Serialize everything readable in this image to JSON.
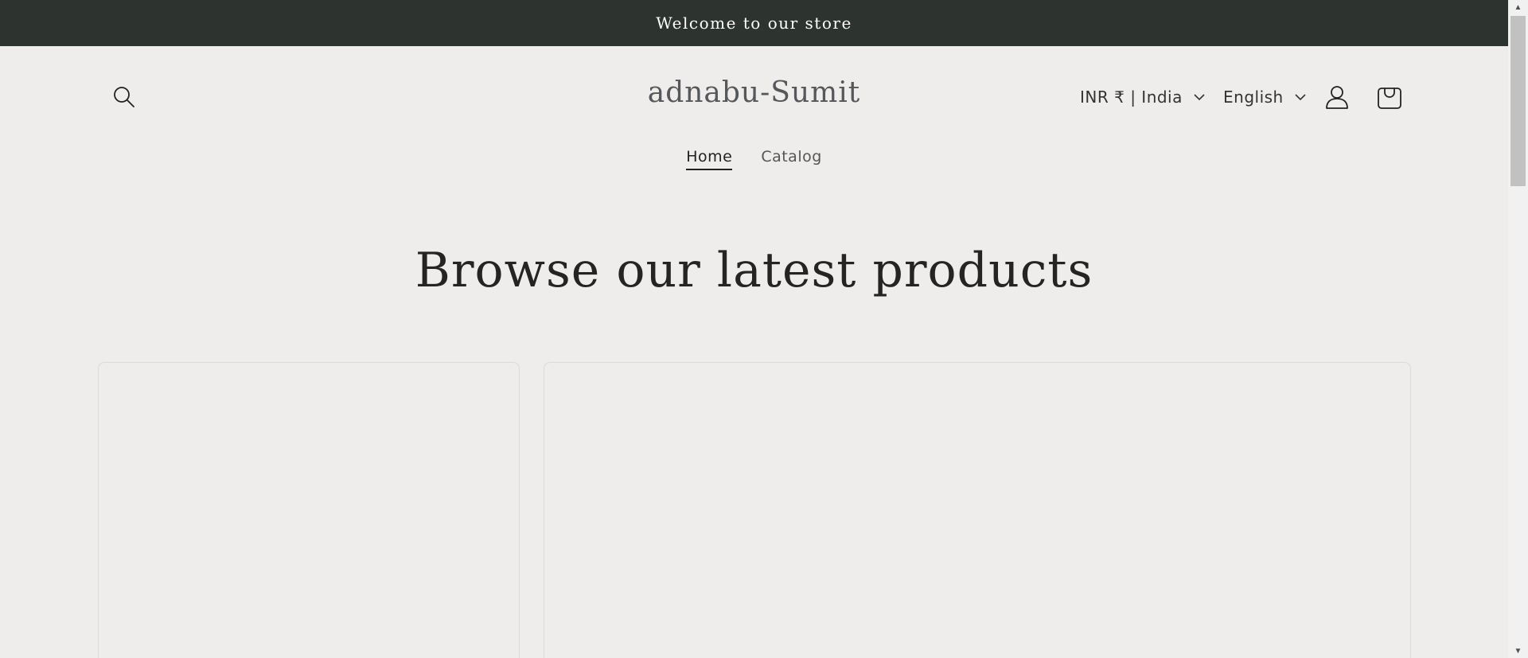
{
  "announcement": {
    "text": "Welcome to our store"
  },
  "header": {
    "logo": "adnabu-Sumit",
    "country_selector": "INR ₹ | India",
    "language_selector": "English",
    "icons": {
      "search": "search-icon",
      "account": "account-icon",
      "cart": "cart-icon"
    }
  },
  "nav": {
    "items": [
      {
        "label": "Home",
        "active": true
      },
      {
        "label": "Catalog",
        "active": false
      }
    ]
  },
  "main": {
    "section_title": "Browse our latest products"
  },
  "colors": {
    "announcement_bg": "#2d332f",
    "page_bg": "#eeedeb",
    "text": "#242424"
  }
}
